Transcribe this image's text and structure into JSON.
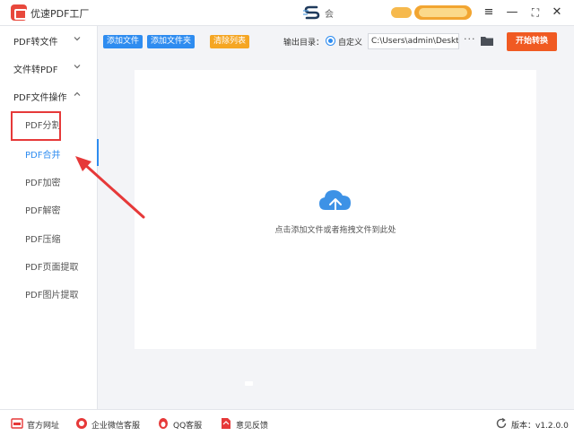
{
  "app": {
    "title": "优速PDF工厂"
  },
  "window": {
    "minimize": "—",
    "maximize": "⛶",
    "close": "✕",
    "menu": "≡",
    "user": "会"
  },
  "sidebar": {
    "groups": [
      {
        "label": "PDF转文件",
        "expanded": false
      },
      {
        "label": "文件转PDF",
        "expanded": false
      },
      {
        "label": "PDF文件操作",
        "expanded": true
      }
    ],
    "items": [
      {
        "label": "PDF分割"
      },
      {
        "label": "PDF合并",
        "active": true
      },
      {
        "label": "PDF加密"
      },
      {
        "label": "PDF解密"
      },
      {
        "label": "PDF压缩"
      },
      {
        "label": "PDF页面提取"
      },
      {
        "label": "PDF图片提取"
      }
    ]
  },
  "toolbar": {
    "add_file": "添加文件",
    "add_folder": "添加文件夹",
    "clear_list": "清除列表",
    "output_label": "输出目录：",
    "custom_label": "自定义",
    "path_value": "C:\\Users\\admin\\Deskto",
    "dots": "···",
    "convert": "开始转换"
  },
  "dropzone": {
    "hint": "点击添加文件或者拖拽文件到此处"
  },
  "footer": {
    "website": "官方网址",
    "wechat": "企业微信客服",
    "qq": "QQ客服",
    "feedback": "意见反馈",
    "version": "版本：v1.2.0.0"
  },
  "colors": {
    "accent": "#2e8cf0",
    "convert": "#f05a22",
    "clear": "#f5a623",
    "highlight": "#e63939"
  }
}
